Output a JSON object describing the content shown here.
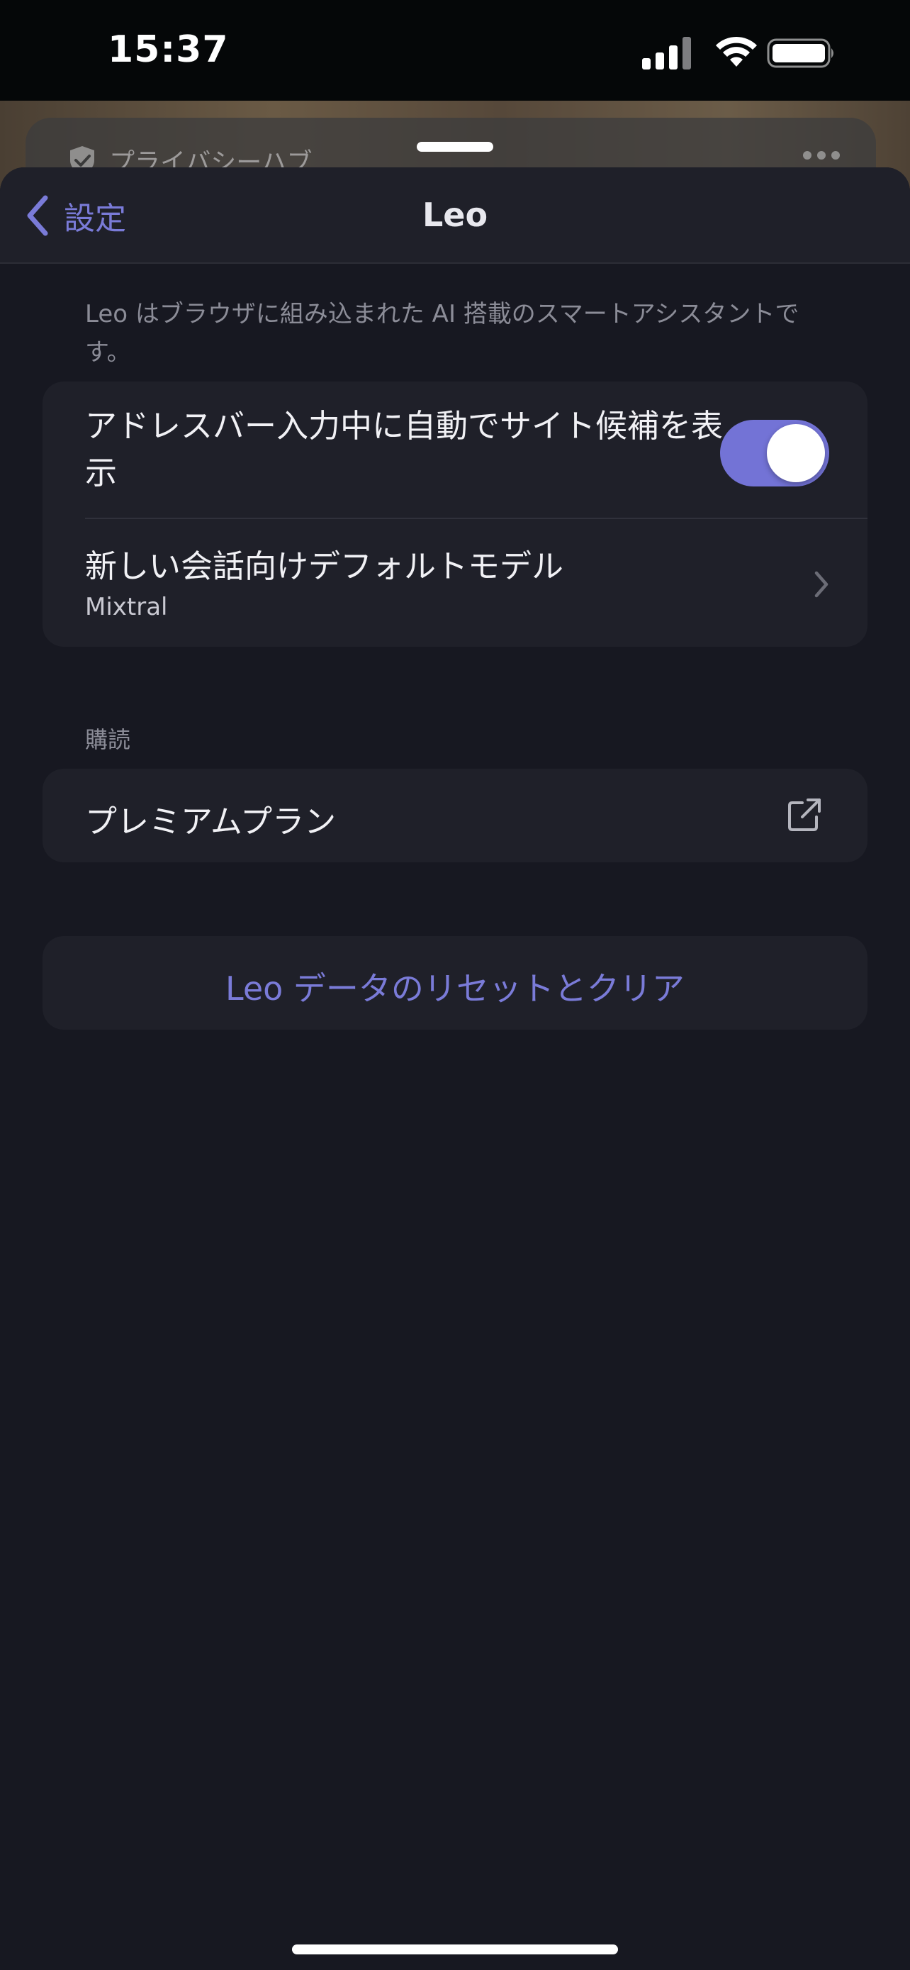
{
  "status_bar": {
    "time": "15:37"
  },
  "background_page": {
    "privacy_hub_label": "プライバシーハブ"
  },
  "nav": {
    "back_label": "設定",
    "title": "Leo"
  },
  "description": "Leo はブラウザに組み込まれた AI 搭載のスマートアシスタントです。",
  "settings": {
    "autocomplete_toggle": {
      "label": "アドレスバー入力中に自動でサイト候補を表示",
      "enabled": true
    },
    "default_model": {
      "label": "新しい会話向けデフォルトモデル",
      "value": "Mixtral"
    }
  },
  "subscription": {
    "header": "購読",
    "premium_label": "プレミアムプラン"
  },
  "reset_button_label": "Leo データのリセットとクリア",
  "colors": {
    "accent": "#7373d6",
    "sheet_background": "#171821",
    "group_background": "#1f2029"
  },
  "icons": [
    "signal-icon",
    "wifi-icon",
    "battery-icon",
    "shield-check-icon",
    "more-icon",
    "chevron-left-icon",
    "chevron-right-icon",
    "external-link-icon"
  ]
}
